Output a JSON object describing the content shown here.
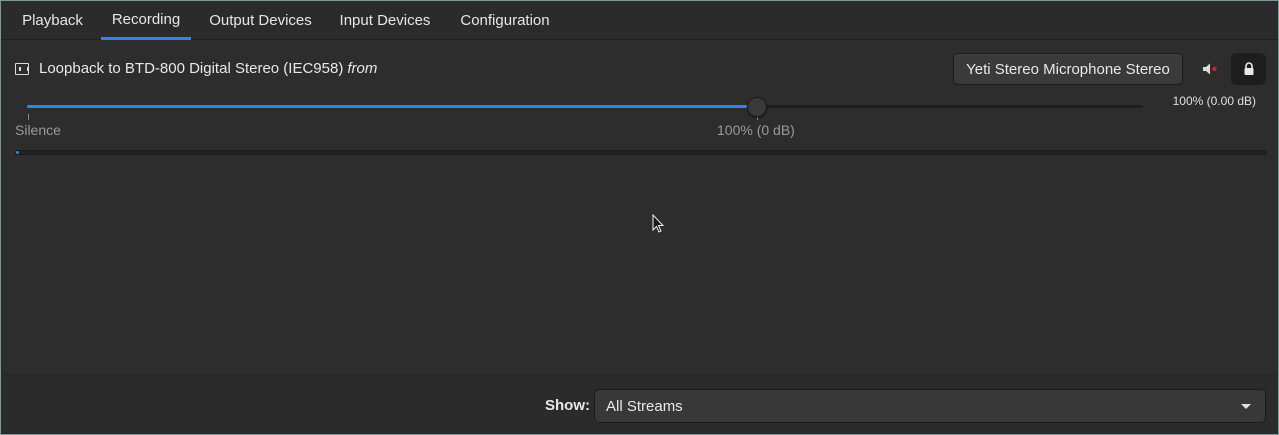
{
  "tabs": [
    {
      "label": "Playback"
    },
    {
      "label": "Recording",
      "active": true
    },
    {
      "label": "Output Devices"
    },
    {
      "label": "Input Devices"
    },
    {
      "label": "Configuration"
    }
  ],
  "stream": {
    "title": "Loopback to BTD-800 Digital Stereo (IEC958)",
    "from_word": "from",
    "device_button": "Yeti Stereo Microphone Stereo",
    "volume_readout": "100% (0.00 dB)",
    "volume_fraction": 0.654,
    "mark_silence": "Silence",
    "mark_100": "100% (0 dB)",
    "level_fraction": 0.002,
    "muted": true,
    "locked": true
  },
  "footer": {
    "show_label": "Show:",
    "show_value": "All Streams"
  },
  "colors": {
    "accent": "#3584e4",
    "mute_dot": "#e01b24"
  }
}
